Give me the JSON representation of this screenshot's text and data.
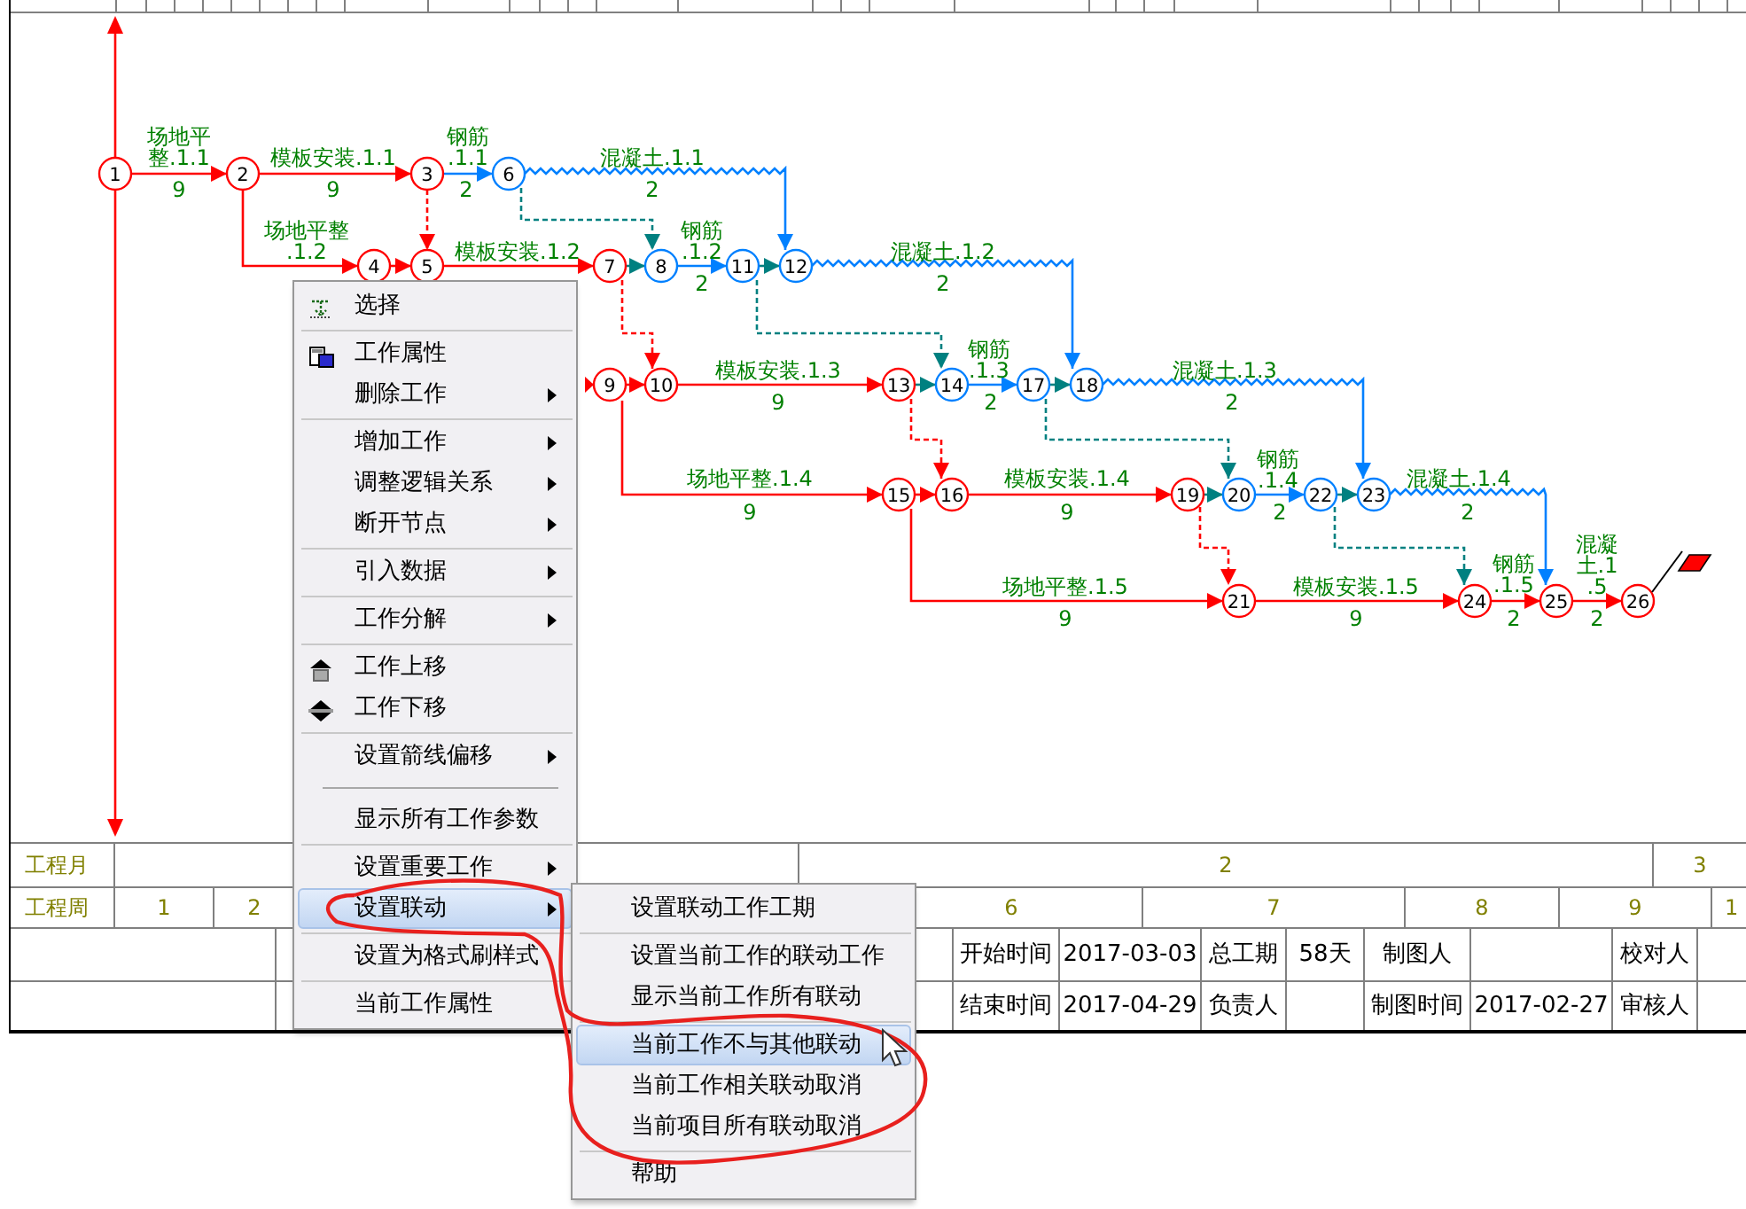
{
  "diagram": {
    "nodes": [
      {
        "label": "1",
        "color": "#ff0000"
      },
      {
        "label": "2",
        "color": "#ff0000"
      },
      {
        "label": "3",
        "color": "#ff0000"
      },
      {
        "label": "4",
        "color": "#ff0000"
      },
      {
        "label": "5",
        "color": "#ff0000"
      },
      {
        "label": "6",
        "color": "#0080ff"
      },
      {
        "label": "7",
        "color": "#ff0000"
      },
      {
        "label": "8",
        "color": "#0080ff"
      },
      {
        "label": "9",
        "color": "#ff0000"
      },
      {
        "label": "10",
        "color": "#ff0000"
      },
      {
        "label": "11",
        "color": "#0080ff"
      },
      {
        "label": "12",
        "color": "#0080ff"
      },
      {
        "label": "13",
        "color": "#ff0000"
      },
      {
        "label": "14",
        "color": "#0080ff"
      },
      {
        "label": "15",
        "color": "#ff0000"
      },
      {
        "label": "16",
        "color": "#ff0000"
      },
      {
        "label": "17",
        "color": "#0080ff"
      },
      {
        "label": "18",
        "color": "#0080ff"
      },
      {
        "label": "19",
        "color": "#ff0000"
      },
      {
        "label": "20",
        "color": "#0080ff"
      },
      {
        "label": "21",
        "color": "#ff0000"
      },
      {
        "label": "22",
        "color": "#0080ff"
      },
      {
        "label": "23",
        "color": "#0080ff"
      },
      {
        "label": "24",
        "color": "#ff0000"
      },
      {
        "label": "25",
        "color": "#ff0000"
      },
      {
        "label": "26",
        "color": "#ff0000"
      }
    ],
    "activities": [
      {
        "kind": "solid",
        "color": "#ff0000",
        "label_lines": [
          "场地平",
          "整.1.1"
        ],
        "duration": "9"
      },
      {
        "kind": "solid",
        "color": "#ff0000",
        "label_lines": [
          "模板安装.1.1"
        ],
        "duration": "9"
      },
      {
        "kind": "solid",
        "color": "#0080ff",
        "label_lines": [
          "钢筋",
          ".1.1"
        ],
        "duration": "2"
      },
      {
        "kind": "wavy",
        "color": "#0080ff",
        "label_lines": [
          "混凝土.1.1"
        ],
        "duration": "2"
      },
      {
        "kind": "solid",
        "color": "#ff0000",
        "label_lines": [
          "场地平整",
          ".1.2"
        ]
      },
      {
        "kind": "solid",
        "color": "#ff0000"
      },
      {
        "kind": "dashed",
        "color": "#ff0000"
      },
      {
        "kind": "solid",
        "color": "#ff0000",
        "label_lines": [
          "模板安装.1.2"
        ]
      },
      {
        "kind": "solid",
        "color": "#008080"
      },
      {
        "kind": "dashed",
        "color": "#008080"
      },
      {
        "kind": "solid",
        "color": "#0080ff",
        "label_lines": [
          "钢筋",
          ".1.2"
        ],
        "duration": "2"
      },
      {
        "kind": "solid",
        "color": "#008080"
      },
      {
        "kind": "wavy",
        "color": "#0080ff",
        "label_lines": [
          "混凝土.1.2"
        ],
        "duration": "2"
      },
      {
        "kind": "dashed",
        "color": "#008080"
      },
      {
        "kind": "dashed",
        "color": "#ff0000"
      },
      {
        "kind": "solid",
        "color": "#ff0000"
      },
      {
        "kind": "solid",
        "color": "#ff0000"
      },
      {
        "kind": "solid",
        "color": "#ff0000",
        "label_lines": [
          "模板安装.1.3"
        ],
        "duration": "9"
      },
      {
        "kind": "solid",
        "color": "#008080"
      },
      {
        "kind": "solid",
        "color": "#0080ff",
        "label_lines": [
          "钢筋",
          ".1.3"
        ],
        "duration": "2"
      },
      {
        "kind": "solid",
        "color": "#008080"
      },
      {
        "kind": "dashed",
        "color": "#ff0000"
      },
      {
        "kind": "dashed",
        "color": "#008080"
      },
      {
        "kind": "wavy",
        "color": "#0080ff",
        "label_lines": [
          "混凝土.1.3"
        ],
        "duration": "2"
      },
      {
        "kind": "solid",
        "color": "#ff0000",
        "label_lines": [
          "场地平整.1.4"
        ],
        "duration": "9"
      },
      {
        "kind": "solid",
        "color": "#ff0000"
      },
      {
        "kind": "solid",
        "color": "#ff0000",
        "label_lines": [
          "模板安装.1.4"
        ],
        "duration": "9"
      },
      {
        "kind": "solid",
        "color": "#008080"
      },
      {
        "kind": "solid",
        "color": "#0080ff",
        "label_lines": [
          "钢筋",
          ".1.4"
        ],
        "duration": "2"
      },
      {
        "kind": "solid",
        "color": "#008080"
      },
      {
        "kind": "dashed",
        "color": "#ff0000"
      },
      {
        "kind": "dashed",
        "color": "#008080"
      },
      {
        "kind": "wavy",
        "color": "#0080ff",
        "label_lines": [
          "混凝土.1.4"
        ],
        "duration": "2"
      },
      {
        "kind": "solid",
        "color": "#ff0000",
        "label_lines": [
          "场地平整.1.5"
        ],
        "duration": "9"
      },
      {
        "kind": "solid",
        "color": "#ff0000",
        "label_lines": [
          "模板安装.1.5"
        ],
        "duration": "9"
      },
      {
        "kind": "solid",
        "color": "#ff0000",
        "label_lines": [
          "钢筋",
          ".1.5"
        ],
        "duration": "2"
      },
      {
        "kind": "solid",
        "color": "#ff0000",
        "label_lines": [
          "混凝",
          "土.1",
          ".5"
        ],
        "duration": "2"
      }
    ]
  },
  "timeline": {
    "month_row": {
      "label": "工程月",
      "cells": [
        "2",
        "3"
      ]
    },
    "week_row": {
      "label": "工程周",
      "cells": [
        "1",
        "2",
        "6",
        "7",
        "8",
        "9",
        "1"
      ]
    }
  },
  "info_table": {
    "rows": [
      [
        {
          "label": "开始时间",
          "value": "2017-03-03"
        },
        {
          "label": "总工期",
          "value": "58天"
        },
        {
          "label": "制图人"
        },
        {
          "label": "校对人"
        }
      ],
      [
        {
          "label": "结束时间",
          "value": "2017-04-29"
        },
        {
          "label": "负责人"
        },
        {
          "label": "制图时间",
          "value": "2017-02-27"
        },
        {
          "label": "审核人"
        }
      ]
    ]
  },
  "context_menu": {
    "items": [
      {
        "kind": "item",
        "label": "选择",
        "selected": false,
        "has_submenu": false
      },
      {
        "kind": "separator"
      },
      {
        "kind": "item",
        "label": "工作属性",
        "selected": false,
        "has_submenu": false
      },
      {
        "kind": "item",
        "label": "删除工作",
        "selected": false,
        "has_submenu": true
      },
      {
        "kind": "separator"
      },
      {
        "kind": "item",
        "label": "增加工作",
        "selected": false,
        "has_submenu": true
      },
      {
        "kind": "item",
        "label": "调整逻辑关系",
        "selected": false,
        "has_submenu": true
      },
      {
        "kind": "item",
        "label": "断开节点",
        "selected": false,
        "has_submenu": true
      },
      {
        "kind": "separator"
      },
      {
        "kind": "item",
        "label": "引入数据",
        "selected": false,
        "has_submenu": true
      },
      {
        "kind": "separator"
      },
      {
        "kind": "item",
        "label": "工作分解",
        "selected": false,
        "has_submenu": true
      },
      {
        "kind": "separator"
      },
      {
        "kind": "item",
        "label": "工作上移",
        "selected": false,
        "has_submenu": false
      },
      {
        "kind": "item",
        "label": "工作下移",
        "selected": false,
        "has_submenu": false
      },
      {
        "kind": "separator"
      },
      {
        "kind": "item",
        "label": "设置箭线偏移",
        "selected": false,
        "has_submenu": true
      },
      {
        "kind": "indented-separator"
      },
      {
        "kind": "item",
        "label": "显示所有工作参数",
        "selected": false,
        "has_submenu": false
      },
      {
        "kind": "separator"
      },
      {
        "kind": "item",
        "label": "设置重要工作",
        "selected": false,
        "has_submenu": true
      },
      {
        "kind": "item",
        "label": "设置联动",
        "selected": true,
        "has_submenu": true
      },
      {
        "kind": "separator"
      },
      {
        "kind": "item",
        "label": "设置为格式刷样式",
        "selected": false,
        "has_submenu": false
      },
      {
        "kind": "separator"
      },
      {
        "kind": "item",
        "label": "当前工作属性",
        "selected": false,
        "has_submenu": false
      }
    ]
  },
  "submenu": {
    "items": [
      {
        "kind": "item",
        "label": "设置联动工作工期",
        "selected": false
      },
      {
        "kind": "separator"
      },
      {
        "kind": "item",
        "label": "设置当前工作的联动工作",
        "selected": false
      },
      {
        "kind": "item",
        "label": "显示当前工作所有联动",
        "selected": false
      },
      {
        "kind": "separator"
      },
      {
        "kind": "item",
        "label": "当前工作不与其他联动",
        "selected": true
      },
      {
        "kind": "item",
        "label": "当前工作相关联动取消",
        "selected": false
      },
      {
        "kind": "item",
        "label": "当前项目所有联动取消",
        "selected": false
      },
      {
        "kind": "separator"
      },
      {
        "kind": "item",
        "label": "帮助",
        "selected": false
      }
    ]
  }
}
